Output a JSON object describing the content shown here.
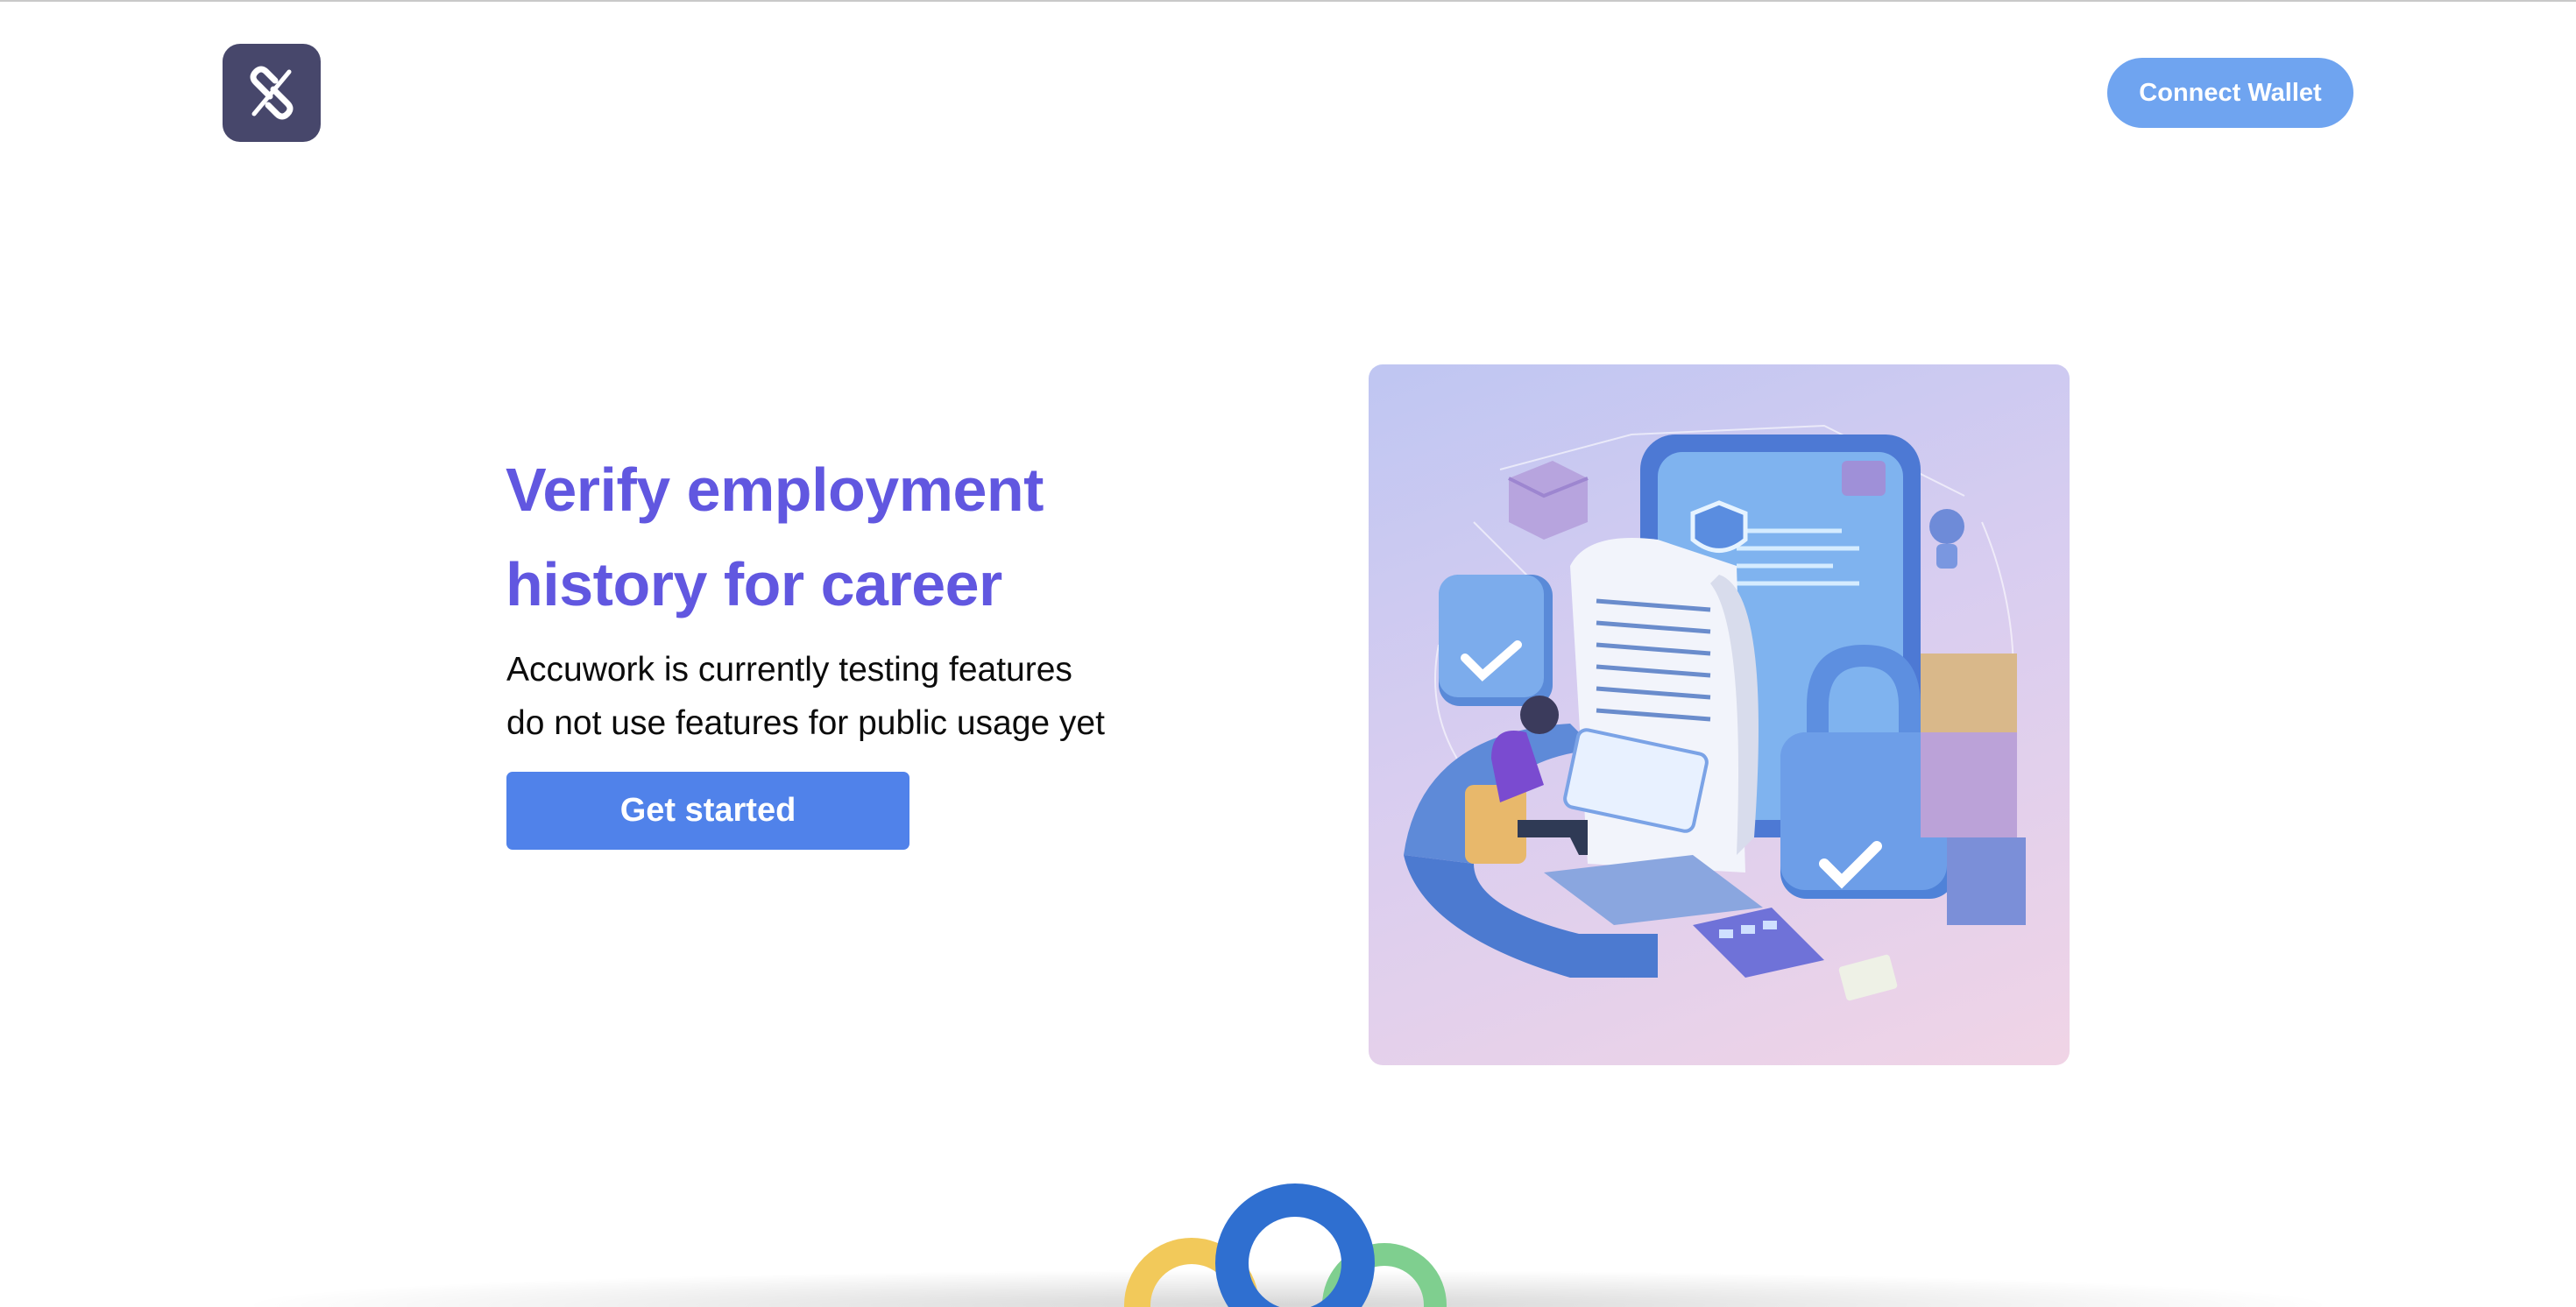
{
  "header": {
    "logo_icon": "chain-link-icon",
    "connect_wallet_label": "Connect Wallet"
  },
  "hero": {
    "title_line1": "Verify employment",
    "title_line2": "history for career",
    "subtitle_line1": "Accuwork is currently testing features",
    "subtitle_line2": "do not use features for public usage yet",
    "cta_label": "Get started",
    "illustration_icon": "employment-verification-illustration"
  },
  "footer": {
    "brand_mark_icon": "interlocking-rings-icon"
  },
  "colors": {
    "accent": "#6157e0",
    "cta": "#5082ea",
    "wallet_button": "#6fa4f0",
    "logo_bg": "#47476b"
  }
}
